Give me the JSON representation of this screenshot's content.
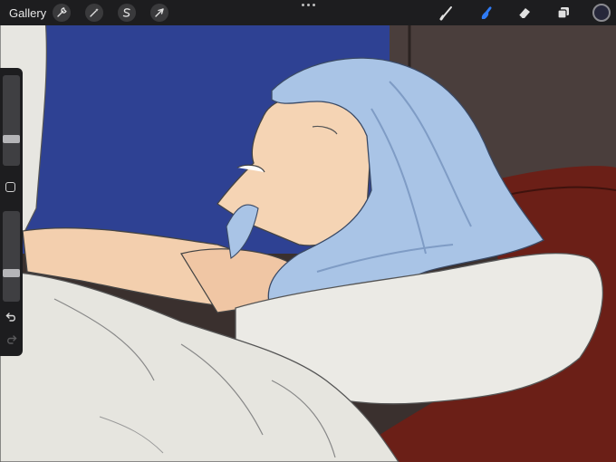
{
  "topbar": {
    "gallery_label": "Gallery",
    "left_tools": [
      {
        "name": "actions",
        "icon": "wrench-icon"
      },
      {
        "name": "adjustments",
        "icon": "magic-wand-icon"
      },
      {
        "name": "selection",
        "icon": "selection-s-icon"
      },
      {
        "name": "transform",
        "icon": "arrow-cursor-icon"
      }
    ],
    "right_tools": [
      {
        "name": "brush",
        "icon": "brush-icon",
        "active": false
      },
      {
        "name": "smudge",
        "icon": "smudge-finger-icon",
        "active": true
      },
      {
        "name": "eraser",
        "icon": "eraser-icon",
        "active": false
      },
      {
        "name": "layers",
        "icon": "layers-icon",
        "active": false
      }
    ],
    "active_tool_color": "#2f7bf5",
    "current_color": "#26273a"
  },
  "sidebar": {
    "brush_size_level": 0.28,
    "opacity_level": 0.3,
    "undo_icon": "undo-icon",
    "redo_icon": "redo-icon"
  },
  "artwork": {
    "description_colors": {
      "night_sky": "#2a3d8c",
      "hair": "#a9c4e6",
      "skin": "#f3cfae",
      "sheets": "#e9e8e3",
      "pillow_red": "#6b1f17"
    }
  }
}
